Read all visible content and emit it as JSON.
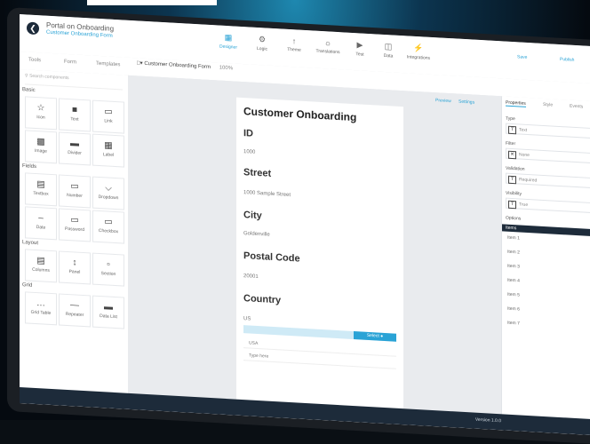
{
  "app": {
    "title": "Portal on Onboarding",
    "subtitle": "Customer Onboarding Form"
  },
  "toolbar": [
    {
      "label": "Designer",
      "icon": "layout-icon",
      "active": true
    },
    {
      "label": "Logic",
      "icon": "logic-icon"
    },
    {
      "label": "Theme",
      "icon": "palette-icon"
    },
    {
      "label": "Translations",
      "icon": "globe-icon"
    },
    {
      "label": "Test",
      "icon": "play-icon"
    },
    {
      "label": "Data",
      "icon": "database-icon"
    },
    {
      "label": "Integrations",
      "icon": "plug-icon"
    }
  ],
  "header_right": {
    "save": "Save",
    "publish": "Publish"
  },
  "left_tabs": [
    "Tools",
    "Form",
    "Templates"
  ],
  "search_placeholder": "Search components",
  "left_sections": [
    {
      "name": "Basic",
      "items": [
        "Icon",
        "Text",
        "Link",
        "Image",
        "Divider",
        "Label"
      ]
    },
    {
      "name": "Fields",
      "items": [
        "Textbox",
        "Number",
        "Dropdown",
        "Date",
        "Password",
        "Checkbox"
      ]
    },
    {
      "name": "Layout",
      "items": [
        "Columns",
        "Panel",
        "Section"
      ]
    },
    {
      "name": "Grid",
      "items": [
        "Grid Table",
        "Repeater",
        "Data List"
      ]
    }
  ],
  "canvas_toolbar": {
    "label": "Customer Onboarding Form",
    "zoom": "100%"
  },
  "canvas_actions": {
    "preview": "Preview",
    "settings": "Settings"
  },
  "form": {
    "title": "Customer Onboarding",
    "fields": [
      {
        "label": "ID",
        "value": "1000"
      },
      {
        "label": "Street",
        "value": "1000 Sample Street"
      },
      {
        "label": "City",
        "value": "Goldenville"
      },
      {
        "label": "Postal Code",
        "value": "20001"
      },
      {
        "label": "Country",
        "value": "US"
      }
    ],
    "dropdown_button": "Select",
    "options": [
      "USA",
      "Type here"
    ]
  },
  "right_tabs": [
    "Properties",
    "Style",
    "Events"
  ],
  "right_props": [
    {
      "label": "Type",
      "value": "Text"
    },
    {
      "label": "Filter",
      "value": "None"
    },
    {
      "label": "Validation",
      "value": "Required"
    },
    {
      "label": "Visibility",
      "value": "True"
    }
  ],
  "right_section": "Options",
  "right_section_header": "Items",
  "right_items": [
    "Item 1",
    "Item 2",
    "Item 3",
    "Item 4",
    "Item 5",
    "Item 6",
    "Item 7"
  ],
  "footer_text": "Version 1.0.0"
}
